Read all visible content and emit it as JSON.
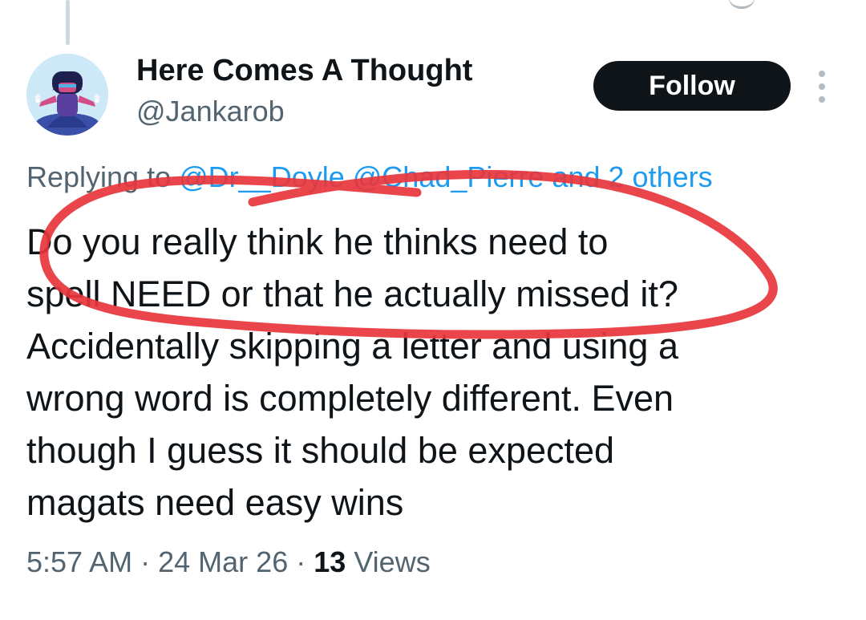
{
  "tweet": {
    "display_name": "Here Comes A Thought",
    "handle": "@Jankarob",
    "follow_label": "Follow",
    "replying": {
      "prefix": "Replying to",
      "mention_1": "@Dr__Doyle",
      "mention_2": "@Chad_Pierre",
      "suffix": "and 2 others"
    },
    "text_lines": [
      "Do you really think he thinks need to",
      "spell NEED or that he actually missed it?",
      "Accidentally skipping a letter and using a",
      "wrong word is completely different. Even",
      "though I guess it should be expected",
      "magats need easy wins"
    ],
    "meta": {
      "time": "5:57 AM",
      "date": "24 Mar 26",
      "separator": "·",
      "views_count": "13",
      "views_label": "Views"
    }
  },
  "icons": {
    "more": "more-vertical-icon",
    "avatar": "avatar-cartoon"
  },
  "colors": {
    "text": "#0f1419",
    "secondary": "#536471",
    "accent": "#1d9bf0",
    "follow_bg": "#0f1419",
    "scribble": "#e8353c"
  }
}
